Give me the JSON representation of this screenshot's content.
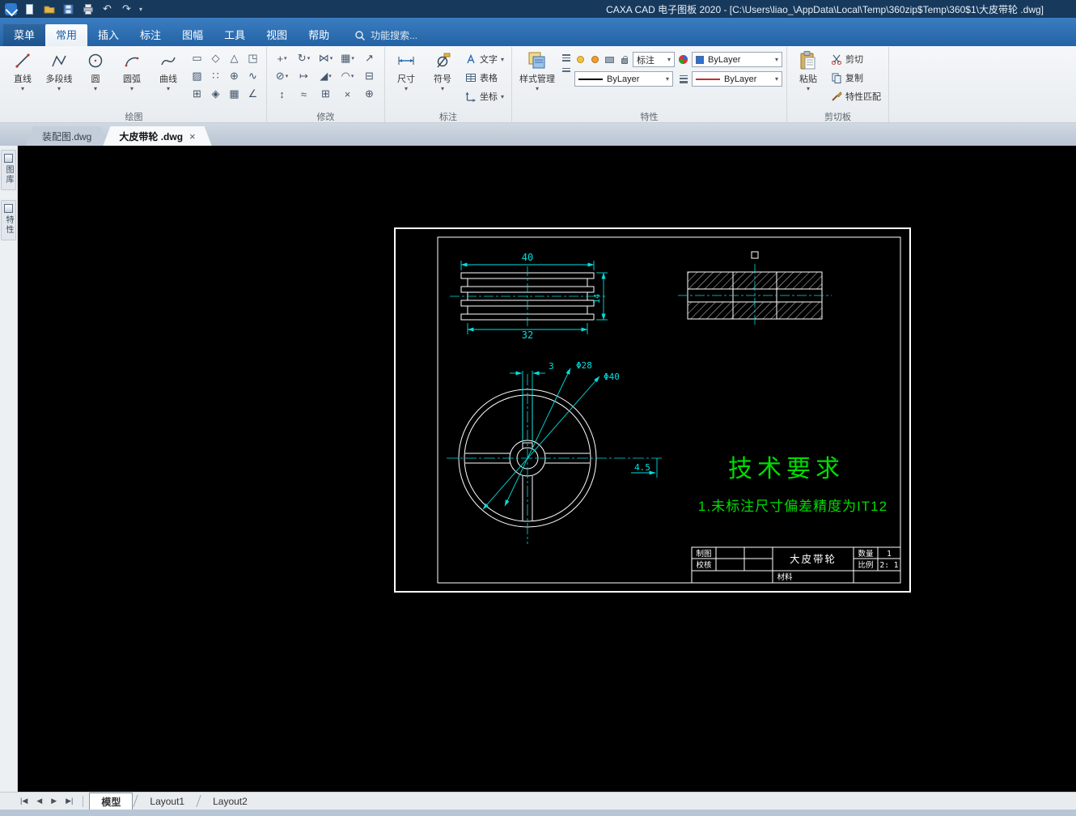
{
  "ui": {
    "caret": "▾",
    "close": "×",
    "undo": "↶",
    "redo": "↷",
    "nav": [
      "|◀",
      "◀",
      "▶",
      "▶|"
    ]
  },
  "titlebar": {
    "title": "CAXA CAD 电子图板 2020 - [C:\\Users\\liao_\\AppData\\Local\\Temp\\360zip$Temp\\360$1\\大皮带轮 .dwg]"
  },
  "menubar": {
    "items": [
      "菜单",
      "常用",
      "插入",
      "标注",
      "图幅",
      "工具",
      "视图",
      "帮助"
    ],
    "search": "功能搜索..."
  },
  "ribbon": {
    "draw": {
      "label": "绘图",
      "big": [
        {
          "label": "直线"
        },
        {
          "label": "多段线"
        },
        {
          "label": "圆"
        },
        {
          "label": "圆弧"
        },
        {
          "label": "曲线"
        }
      ],
      "small": [
        "▭",
        "◇",
        "△",
        "◳",
        "▨",
        "∷",
        "⊕",
        "∿",
        "⊞",
        "◈",
        "▦",
        "∠"
      ]
    },
    "modify": {
      "label": "修改",
      "small": [
        "+",
        "↻",
        "⋈",
        "▦",
        "↗",
        "⊘",
        "↦",
        "◢",
        "◠",
        "⊟",
        "↕",
        "≈",
        "⊞",
        "×",
        "⊕"
      ]
    },
    "annotate": {
      "label": "标注",
      "dim": "尺寸",
      "symbol": "符号",
      "stack": [
        "文字",
        "表格",
        "坐标"
      ]
    },
    "props": {
      "label": "特性",
      "style_mgr": "样式管理",
      "style_combo": "标注",
      "linetype": "ByLayer",
      "color": "ByLayer",
      "lineweight": "ByLayer"
    },
    "clipboard": {
      "label": "剪切板",
      "paste": "粘贴",
      "items": [
        "剪切",
        "复制",
        "特性匹配"
      ]
    }
  },
  "doctabs": [
    {
      "label": "装配图.dwg"
    },
    {
      "label": "大皮带轮 .dwg"
    }
  ],
  "leftdock": {
    "items": [
      "图库",
      "特性"
    ]
  },
  "canvas": {
    "dims": {
      "top_width": "40",
      "bottom_width": "32",
      "side_height": "14",
      "key_width": "3",
      "bore_dia": "Φ28",
      "hub_dia": "Φ40",
      "key_depth": "4.5"
    },
    "tech_title": "技术要求",
    "tech_note": "1.未标注尺寸偏差精度为IT12",
    "titleblock": {
      "draw": "制图",
      "check": "校核",
      "material": "材料",
      "part": "大皮带轮",
      "qty_label": "数量",
      "qty": "1",
      "scale_label": "比例",
      "scale": "2: 1"
    }
  },
  "bottombar": {
    "tabs": [
      "模型",
      "Layout1",
      "Layout2"
    ]
  },
  "colors": {
    "cad_white": "#ffffff",
    "cad_cyan": "#00e0e0",
    "cad_green": "#00dd00"
  }
}
